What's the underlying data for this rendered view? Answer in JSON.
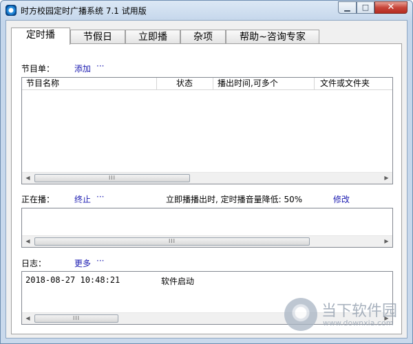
{
  "window": {
    "title": "时方校园定时广播系统 7.1 试用版",
    "controls": {
      "minimize": "▁",
      "maximize": "□",
      "close": "✕"
    }
  },
  "tabs": [
    {
      "label": "定时播",
      "active": true
    },
    {
      "label": "节假日"
    },
    {
      "label": "立即播"
    },
    {
      "label": "杂项"
    },
    {
      "label": "帮助~咨询专家"
    }
  ],
  "program": {
    "label": "节目单：",
    "add_link": "添加",
    "more": "···",
    "columns": [
      "节目名称",
      "状态",
      "播出时间,可多个",
      "文件或文件夹"
    ]
  },
  "playing": {
    "label": "正在播：",
    "stop_link": "终止",
    "more": "···",
    "note": "立即播播出时, 定时播音量降低: 50%",
    "modify_link": "修改"
  },
  "log": {
    "label": "日志：",
    "more_link": "更多",
    "more": "···",
    "entries": [
      {
        "time": "2018-08-27 10:48:21",
        "msg": "软件启动"
      }
    ]
  },
  "scroll_glyphs": {
    "left": "◀",
    "right": "▶",
    "grip": "III"
  },
  "watermark": {
    "text": "当下软件园",
    "url": "www.downxia.com"
  }
}
